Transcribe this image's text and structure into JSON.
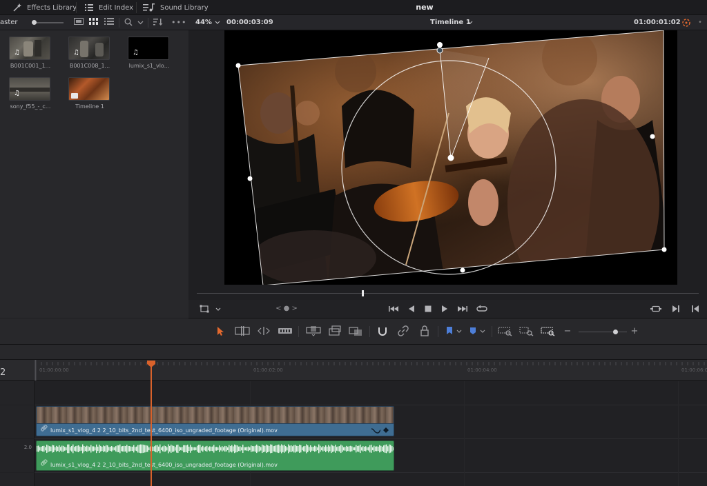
{
  "menu": {
    "effects_library": "Effects Library",
    "edit_index": "Edit Index",
    "sound_library": "Sound Library",
    "project_title": "new"
  },
  "media_pool": {
    "bin_label": "aster",
    "clips": [
      {
        "name": "B001C001_1...",
        "type": "video"
      },
      {
        "name": "B001C008_1...",
        "type": "video"
      },
      {
        "name": "lumix_s1_vlo...",
        "type": "audio"
      },
      {
        "name": "sony_f55_-_c...",
        "type": "video"
      },
      {
        "name": "Timeline 1",
        "type": "timeline"
      }
    ]
  },
  "viewer": {
    "zoom": "44%",
    "source_timecode": "00:00:03:09",
    "timeline_name": "Timeline 1",
    "record_timecode": "01:00:01:02",
    "nav_label": "< ● >"
  },
  "timeline": {
    "track_number": "2",
    "ruler_labels": [
      "01:00:00:00",
      "01:00:02:00",
      "01:00:04:00",
      "01:00:06:00"
    ],
    "audio_level": "2.0",
    "video_clip_name": "lumix_s1_vlog_4 2 2_10_bits_2nd_test_6400_iso_ungraded_footage (Original).mov",
    "audio_clip_name": "lumix_s1_vlog_4 2 2_10_bits_2nd_test_6400_iso_ungraded_footage (Original).mov"
  },
  "colors": {
    "accent": "#e3692e",
    "video_clip": "#3f6d92",
    "audio_clip": "#3f9b5b",
    "playhead": "#d9622b"
  }
}
